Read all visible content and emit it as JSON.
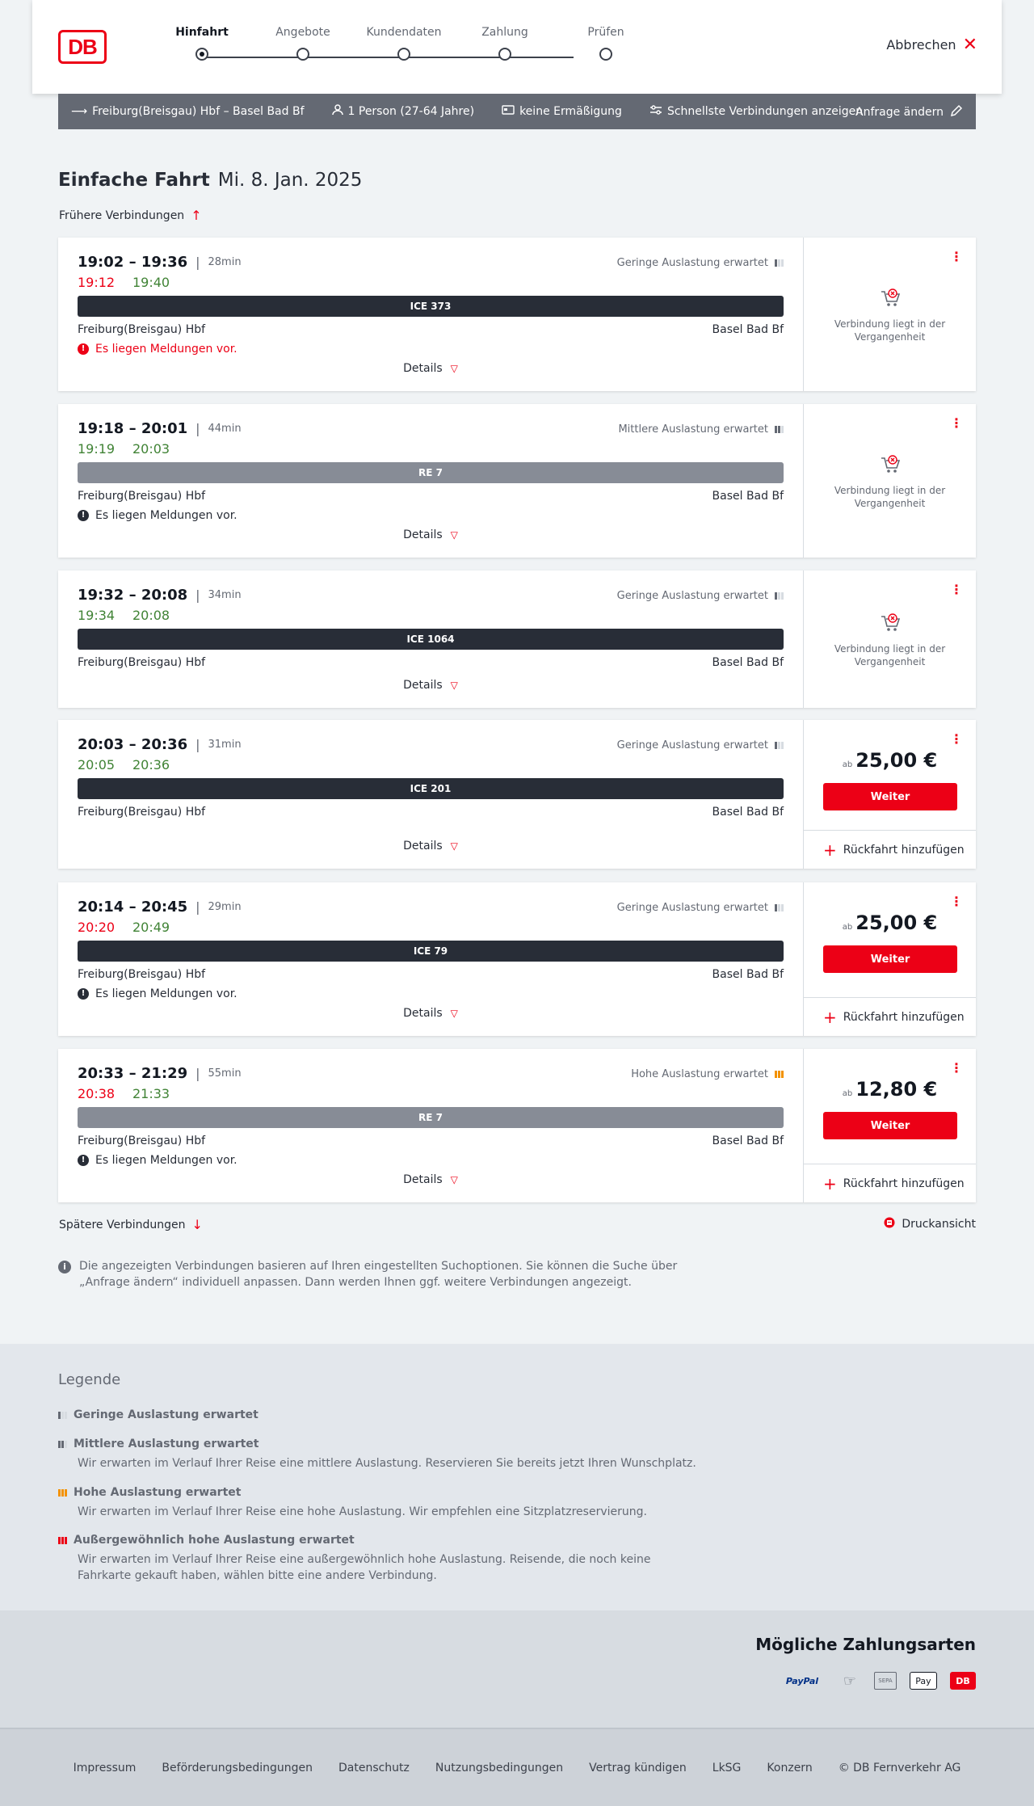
{
  "header": {
    "logo_text": "DB",
    "steps": [
      {
        "label": "Hinfahrt",
        "active": true
      },
      {
        "label": "Angebote",
        "active": false
      },
      {
        "label": "Kundendaten",
        "active": false
      },
      {
        "label": "Zahlung",
        "active": false
      },
      {
        "label": "Prüfen",
        "active": false
      }
    ],
    "cancel_label": "Abbrechen"
  },
  "summary": {
    "route": "Freiburg(Breisgau) Hbf – Basel Bad Bf",
    "travellers": "1 Person (27-64 Jahre)",
    "discount": "keine Ermäßigung",
    "fastest": "Schnellste Verbindungen anzeigen",
    "edit": "Anfrage ändern"
  },
  "title": {
    "trip": "Einfache Fahrt",
    "date": "Mi. 8. Jan. 2025"
  },
  "earlier": "Frühere Verbindungen",
  "later": "Spätere Verbindungen",
  "print": "Druckansicht",
  "details_label": "Details",
  "past_label": "Verbindung liegt in der Vergangenheit",
  "weiter_label": "Weiter",
  "return_label": "Rückfahrt hinzufügen",
  "price_prefix": "ab",
  "connections": [
    {
      "times": "19:02 – 19:36",
      "duration": "28min",
      "rt_dep": "19:12",
      "rt_arr": "19:40",
      "rt_dep_color": "red",
      "rt_arr_color": "green",
      "load": "Geringe Auslastung erwartet",
      "load_level": 1,
      "train": "ICE 373",
      "train_type": "ice",
      "from": "Freiburg(Breisgau) Hbf",
      "to": "Basel Bad Bf",
      "message": "Es liegen Meldungen vor.",
      "message_color": "red",
      "past": true
    },
    {
      "times": "19:18 – 20:01",
      "duration": "44min",
      "rt_dep": "19:19",
      "rt_arr": "20:03",
      "rt_dep_color": "green",
      "rt_arr_color": "green",
      "load": "Mittlere Auslastung erwartet",
      "load_level": 2,
      "train": "RE 7",
      "train_type": "re",
      "from": "Freiburg(Breisgau) Hbf",
      "to": "Basel Bad Bf",
      "message": "Es liegen Meldungen vor.",
      "message_color": "black",
      "past": true
    },
    {
      "times": "19:32 – 20:08",
      "duration": "34min",
      "rt_dep": "19:34",
      "rt_arr": "20:08",
      "rt_dep_color": "green",
      "rt_arr_color": "green",
      "load": "Geringe Auslastung erwartet",
      "load_level": 1,
      "train": "ICE 1064",
      "train_type": "ice",
      "from": "Freiburg(Breisgau) Hbf",
      "to": "Basel Bad Bf",
      "message": "",
      "past": true
    },
    {
      "times": "20:03 – 20:36",
      "duration": "31min",
      "rt_dep": "20:05",
      "rt_arr": "20:36",
      "rt_dep_color": "green",
      "rt_arr_color": "green",
      "load": "Geringe Auslastung erwartet",
      "load_level": 1,
      "train": "ICE 201",
      "train_type": "ice",
      "from": "Freiburg(Breisgau) Hbf",
      "to": "Basel Bad Bf",
      "message": "",
      "past": false,
      "price": "25,00 €"
    },
    {
      "times": "20:14 – 20:45",
      "duration": "29min",
      "rt_dep": "20:20",
      "rt_arr": "20:49",
      "rt_dep_color": "red",
      "rt_arr_color": "green",
      "load": "Geringe Auslastung erwartet",
      "load_level": 1,
      "train": "ICE 79",
      "train_type": "ice",
      "from": "Freiburg(Breisgau) Hbf",
      "to": "Basel Bad Bf",
      "message": "Es liegen Meldungen vor.",
      "message_color": "black",
      "past": false,
      "price": "25,00 €"
    },
    {
      "times": "20:33 – 21:29",
      "duration": "55min",
      "rt_dep": "20:38",
      "rt_arr": "21:33",
      "rt_dep_color": "red",
      "rt_arr_color": "green",
      "load": "Hohe Auslastung erwartet",
      "load_level": 3,
      "train": "RE 7",
      "train_type": "re",
      "from": "Freiburg(Breisgau) Hbf",
      "to": "Basel Bad Bf",
      "message": "Es liegen Meldungen vor.",
      "message_color": "black",
      "past": false,
      "price": "12,80 €"
    }
  ],
  "info_text": "Die angezeigten Verbindungen basieren auf Ihren eingestellten Suchoptionen. Sie können die Suche über „Anfrage ändern“ individuell anpassen. Dann werden Ihnen ggf. weitere Verbindungen angezeigt.",
  "legend": {
    "title": "Legende",
    "items": [
      {
        "title": "Geringe Auslastung erwartet",
        "desc": ""
      },
      {
        "title": "Mittlere Auslastung erwartet",
        "desc": "Wir erwarten im Verlauf Ihrer Reise eine mittlere Auslastung. Reservieren Sie bereits jetzt Ihren Wunschplatz."
      },
      {
        "title": "Hohe Auslastung erwartet",
        "desc": "Wir erwarten im Verlauf Ihrer Reise eine hohe Auslastung. Wir empfehlen eine Sitzplatzreservierung."
      },
      {
        "title": "Außergewöhnlich hohe Auslastung erwartet",
        "desc": "Wir erwarten im Verlauf Ihrer Reise eine außergewöhnlich hohe Auslastung. Reisende, die noch keine Fahrkarte gekauft haben, wählen bitte eine andere Verbindung."
      }
    ]
  },
  "payment": {
    "title": "Mögliche Zahlungsarten",
    "methods": [
      "PayPal",
      "Kreditkarte",
      "SEPA",
      "Pay",
      "DB"
    ]
  },
  "footer": {
    "links": [
      "Impressum",
      "Beförderungsbedingungen",
      "Datenschutz",
      "Nutzungsbedingungen",
      "Vertrag kündigen",
      "LkSG",
      "Konzern",
      "© DB Fernverkehr AG"
    ]
  },
  "colors": {
    "accent": "#ec0016",
    "green": "#408335",
    "dark": "#282d37",
    "high_load": "#f39200"
  }
}
